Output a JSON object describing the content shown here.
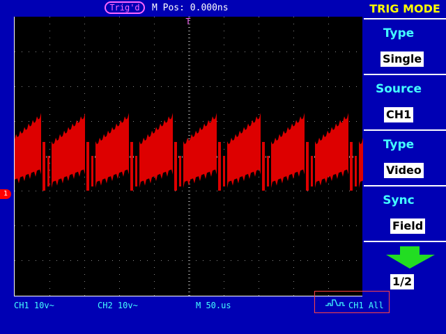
{
  "header": {
    "trig_status": "Trig'd",
    "m_pos": "M Pos: 0.000ns"
  },
  "markers": {
    "trigger_top": "T",
    "ch1": "1"
  },
  "footer": {
    "ch1": "CH1 10v~",
    "ch2": "CH2 10v~",
    "timebase": "M 50.us",
    "trigger_source": "CH1 All"
  },
  "menu": {
    "title": "TRIG MODE",
    "items": [
      {
        "label": "Type",
        "value": "Single"
      },
      {
        "label": "Source",
        "value": "CH1"
      },
      {
        "label": "Type",
        "value": "Video"
      },
      {
        "label": "Sync",
        "value": "Field"
      }
    ],
    "page": "1/2"
  },
  "colors": {
    "background": "#0000b4",
    "screen": "#000000",
    "waveform": "#dd0000",
    "menu_label": "#44ffff",
    "title": "#ffff00",
    "trigger": "#ff66ff"
  }
}
